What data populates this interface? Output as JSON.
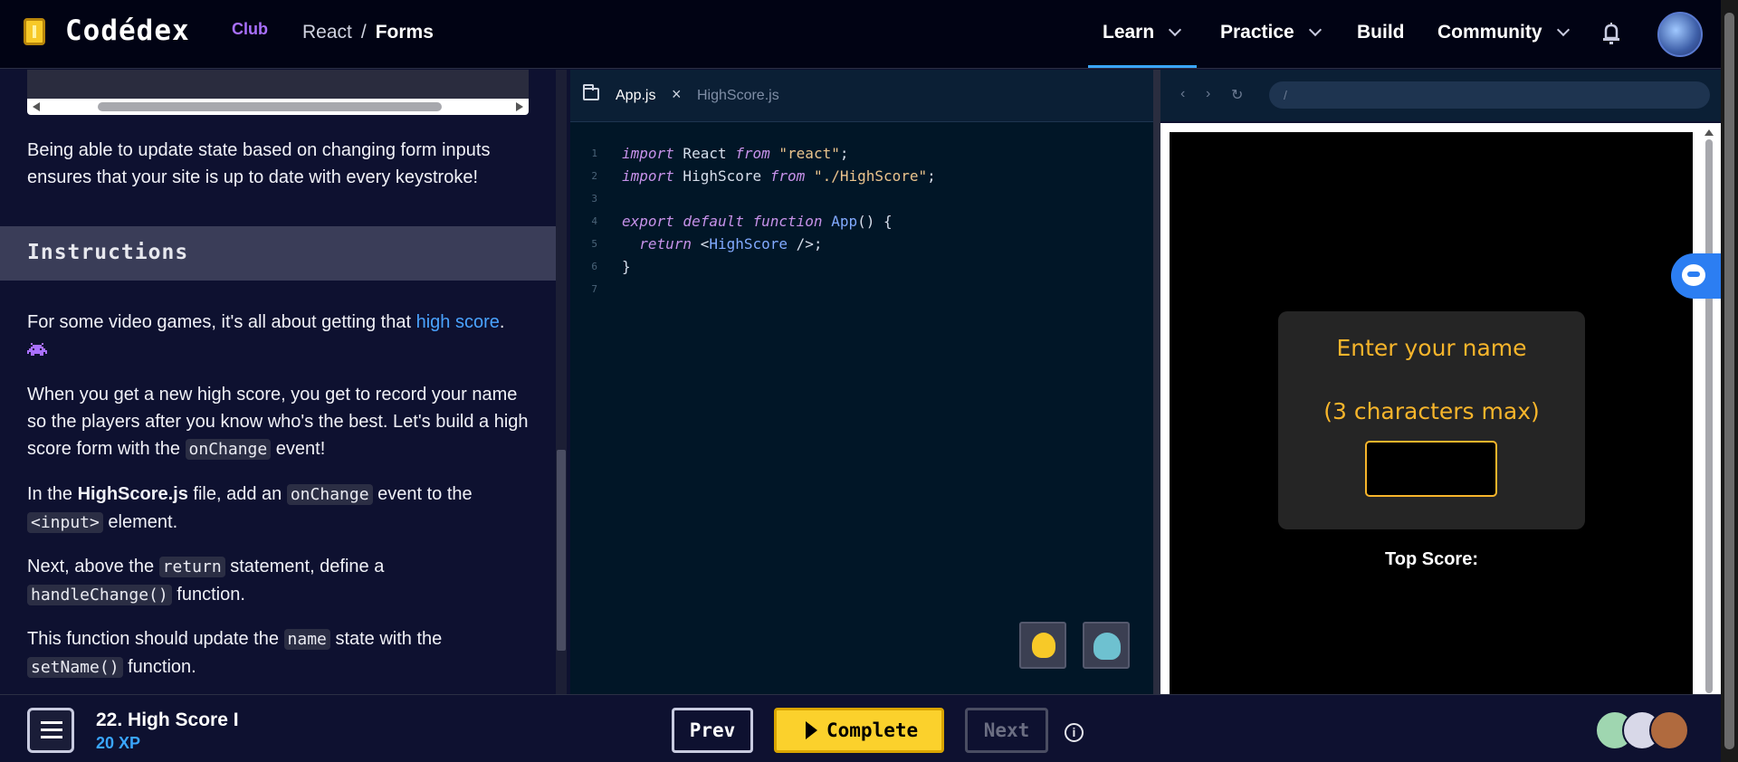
{
  "header": {
    "logo": "Codédex",
    "logo_suffix": "Club",
    "breadcrumb": {
      "course": "React",
      "separator": "/",
      "lesson": "Forms"
    },
    "nav": [
      {
        "label": "Learn"
      },
      {
        "label": "Practice"
      },
      {
        "label": "Build"
      },
      {
        "label": "Community"
      }
    ]
  },
  "lesson": {
    "intro": "Being able to update state based on changing form inputs ensures that your site is up to date with every keystroke!",
    "instructions_heading": "Instructions",
    "p1_before": "For some video games, it's all about getting that ",
    "p1_link": "high score",
    "p1_after": ".",
    "p2_before": "When you get a new high score, you get to record your name so the players after you know who's the best. Let's build a high score form with the ",
    "p2_code": "onChange",
    "p2_after": " event!",
    "p3_a": "In the ",
    "p3_bold": "HighScore.js",
    "p3_b": " file, add an ",
    "p3_code1": "onChange",
    "p3_c": " event to the ",
    "p3_code2": "<input>",
    "p3_d": " element.",
    "p4_a": "Next, above the ",
    "p4_code1": "return",
    "p4_b": " statement, define a ",
    "p4_code2": "handleChange()",
    "p4_c": " function.",
    "p5_a": "This function should update the ",
    "p5_code1": "name",
    "p5_b": " state with the ",
    "p5_code2": "setName()",
    "p5_c": " function."
  },
  "editor": {
    "tabs": [
      {
        "label": "App.js",
        "active": true
      },
      {
        "label": "HighScore.js",
        "active": false
      }
    ],
    "close_glyph": "×",
    "lines": [
      {
        "num": "1"
      },
      {
        "num": "2"
      },
      {
        "num": "3"
      },
      {
        "num": "4"
      },
      {
        "num": "5"
      },
      {
        "num": "6"
      },
      {
        "num": "7"
      }
    ]
  },
  "preview": {
    "url": "/",
    "card_title_1": "Enter your name",
    "card_title_2": "(3 characters max)",
    "top_score": "Top Score:"
  },
  "footer": {
    "lesson_title": "22. High Score I",
    "xp": "20 XP",
    "prev": "Prev",
    "complete": "Complete",
    "next": "Next",
    "info": "i"
  },
  "colors": {
    "accent": "#3aa6ff",
    "complete": "#fbd12c",
    "card_text": "#f7b52b"
  }
}
